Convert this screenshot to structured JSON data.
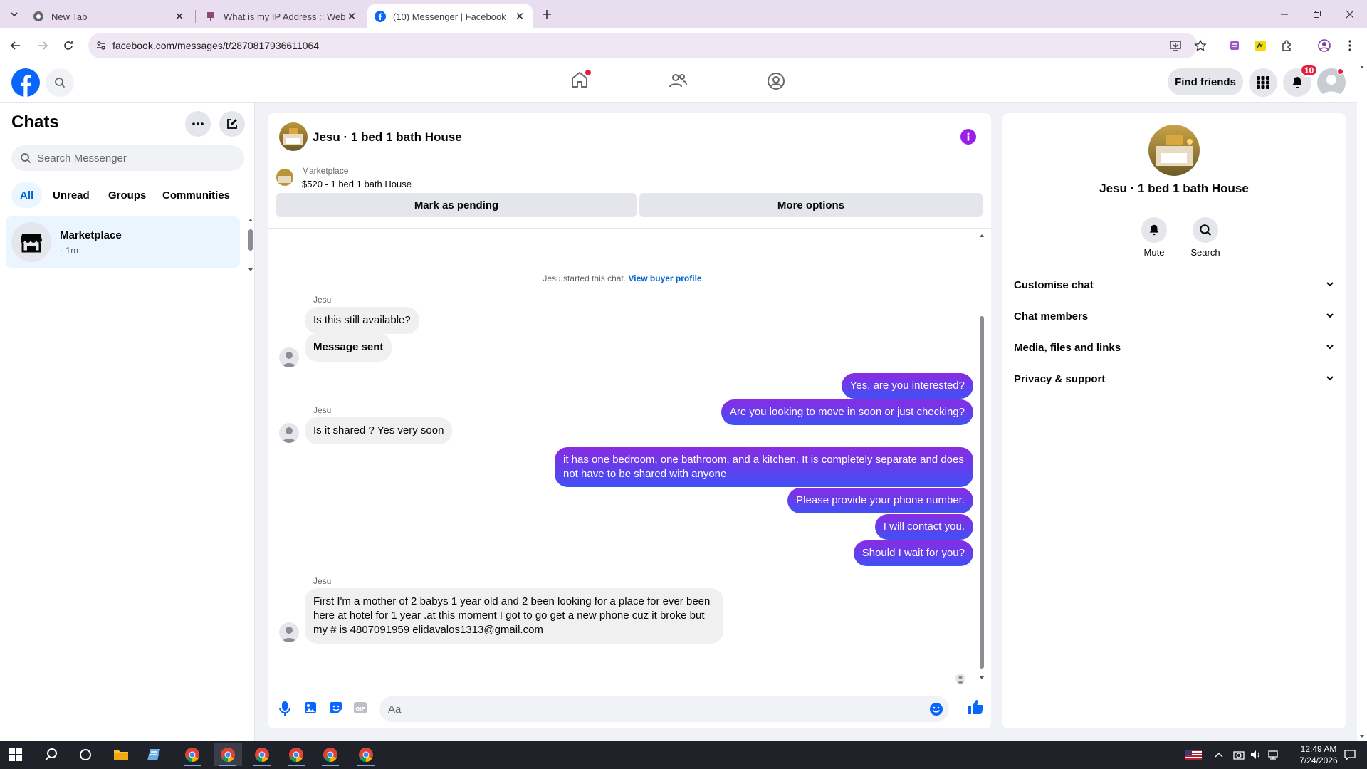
{
  "browser": {
    "tabs": [
      {
        "title": "New Tab",
        "active": false
      },
      {
        "title": "What is my IP Address :: WebBrowserTools",
        "active": false
      },
      {
        "title": "(10) Messenger | Facebook",
        "active": true
      }
    ],
    "url": "facebook.com/messages/t/2870817936611064"
  },
  "header": {
    "find_friends": "Find friends",
    "notification_count": "10"
  },
  "sidebar": {
    "title": "Chats",
    "search_placeholder": "Search Messenger",
    "filters": [
      "All",
      "Unread",
      "Groups",
      "Communities"
    ],
    "active_filter": "All",
    "chats": [
      {
        "name": "Marketplace",
        "time": "· 1m"
      }
    ]
  },
  "conversation": {
    "title": "Jesu · 1 bed 1 bath House",
    "marketplace_label": "Marketplace",
    "listing": "$520 - 1 bed 1 bath House",
    "mark_pending": "Mark as pending",
    "more_options": "More options",
    "system_text": "Jesu started this chat.",
    "system_link": "View buyer profile",
    "messages": [
      {
        "sender": "Jesu",
        "text": "Is this still available?",
        "dir": "in"
      },
      {
        "text": "Message sent",
        "dir": "in"
      },
      {
        "text": "Yes, are you interested?",
        "dir": "out"
      },
      {
        "text": "Are you looking to move in soon or just checking?",
        "dir": "out"
      },
      {
        "sender": "Jesu",
        "text": "Is it shared ?  Yes very soon",
        "dir": "in"
      },
      {
        "text": "it has one bedroom, one bathroom, and a kitchen. It is completely separate and does not have to be shared with anyone",
        "dir": "out"
      },
      {
        "text": "Please provide your phone number.",
        "dir": "out"
      },
      {
        "text": "I will contact you.",
        "dir": "out"
      },
      {
        "text": "Should I wait for you?",
        "dir": "out"
      },
      {
        "sender": "Jesu",
        "text": "First I'm a mother of 2 babys 1 year old and 2 been looking for a place for ever been here at hotel for 1 year .at this moment I got to go get a new phone cuz it broke but my # is 4807091959 elidavalos1313@gmail.com",
        "dir": "in"
      }
    ],
    "composer_placeholder": "Aa"
  },
  "info_panel": {
    "name": "Jesu · 1 bed 1 bath House",
    "actions": [
      "Mute",
      "Search"
    ],
    "sections": [
      "Customise chat",
      "Chat members",
      "Media, files and links",
      "Privacy & support"
    ]
  },
  "taskbar": {
    "time": "12:49 AM",
    "date": "7/24/2026"
  },
  "colors": {
    "messenger_blue": "#0866ff",
    "bubble_gradient_top": "#8a2be2",
    "bubble_gradient_bottom": "#3f51f5",
    "selected_bg": "#ebf5ff"
  }
}
